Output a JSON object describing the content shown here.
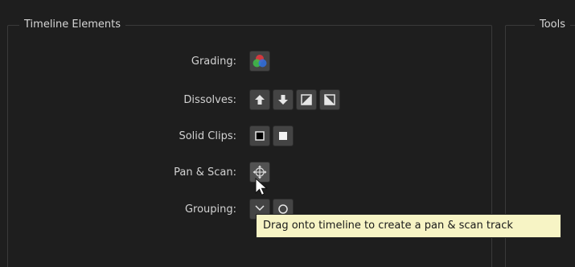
{
  "groups": {
    "timeline_elements": "Timeline Elements",
    "tools": "Tools"
  },
  "rows": {
    "grading": {
      "label": "Grading:"
    },
    "dissolves": {
      "label": "Dissolves:"
    },
    "solid_clips": {
      "label": "Solid Clips:"
    },
    "pan_scan": {
      "label": "Pan & Scan:"
    },
    "grouping": {
      "label": "Grouping:"
    }
  },
  "tooltip": {
    "text": "Drag onto timeline to create a pan & scan track"
  },
  "icons": {
    "grading": "color-wheels-icon",
    "dissolves": [
      "arrow-up-icon",
      "arrow-down-icon",
      "dissolve-up-icon",
      "dissolve-down-icon"
    ],
    "solid_clips": [
      "black-solid-icon",
      "white-solid-icon"
    ],
    "pan_scan": "move-crosshair-icon",
    "grouping": [
      "group-bracket-icon",
      "group-circle-icon"
    ],
    "cursor": "mouse-pointer-icon"
  },
  "colors": {
    "background": "#1e1e1e",
    "button": "#444444",
    "tooltip_bg": "#f7f4c5",
    "grading_red": "#e0393e",
    "grading_green": "#3fbf4a",
    "grading_blue": "#2f6fe0"
  }
}
